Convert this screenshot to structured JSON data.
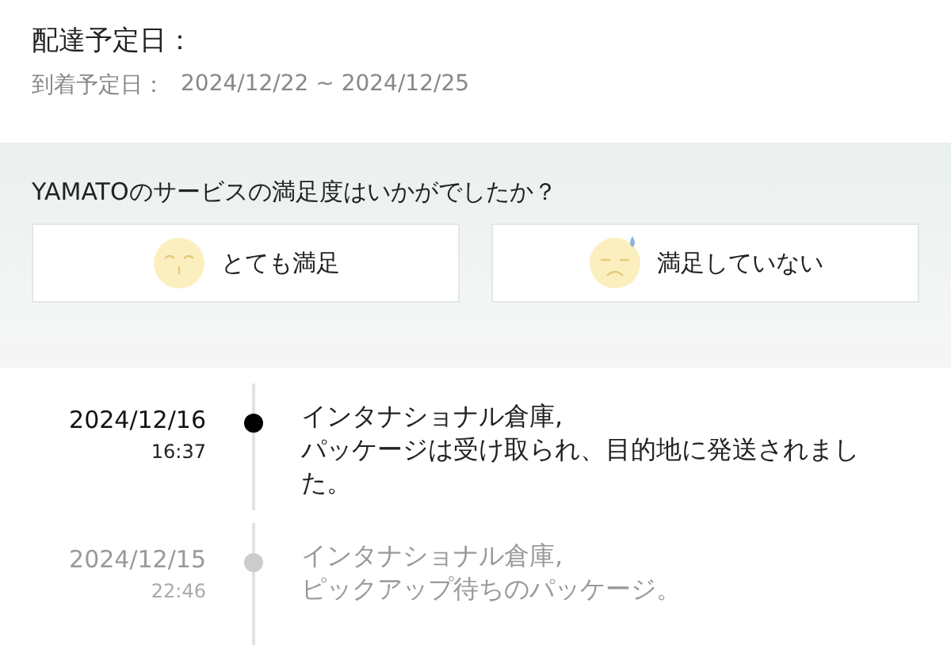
{
  "delivery": {
    "title": "配達予定日：",
    "eta_label": "到着予定日：",
    "eta_value": "2024/12/22 ~ 2024/12/25"
  },
  "survey": {
    "question": "YAMATOのサービスの満足度はいかがでしたか？",
    "options": [
      {
        "kind": "happy",
        "label": "とても満足"
      },
      {
        "kind": "sad",
        "label": "満足していない"
      }
    ]
  },
  "timeline": [
    {
      "date": "2024/12/16",
      "time": "16:37",
      "text": "インタナショナル倉庫,\nパッケージは受け取られ、目的地に発送されました。",
      "current": true
    },
    {
      "date": "2024/12/15",
      "time": "22:46",
      "text": "インタナショナル倉庫,\nピックアップ待ちのパッケージ。",
      "current": false
    }
  ]
}
